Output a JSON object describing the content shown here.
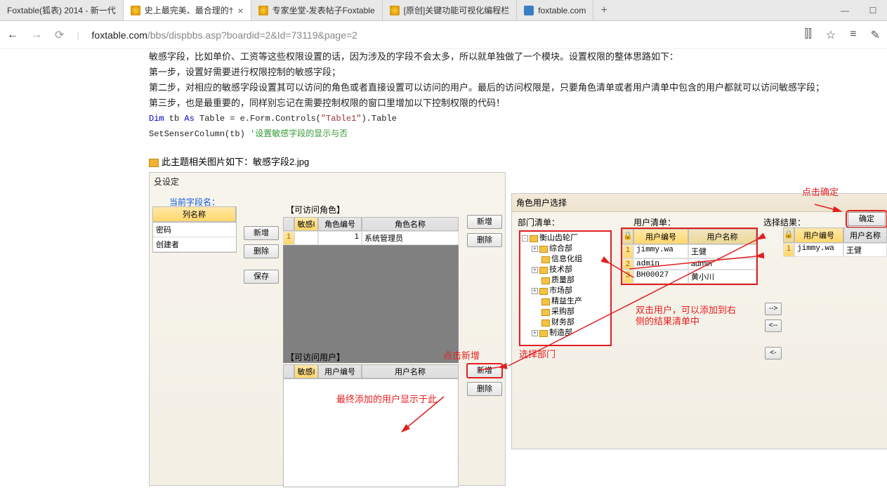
{
  "tabs": [
    {
      "title": "Foxtable(狐表) 2014 - 新一代"
    },
    {
      "title": "史上最完美、最合理的†"
    },
    {
      "title": "专家坐堂-发表帖子Foxtable"
    },
    {
      "title": "[原创]关键功能可视化编程栏"
    },
    {
      "title": "foxtable.com"
    }
  ],
  "url_prefix": "foxtable.com",
  "url_path": "/bbs/dispbbs.asp?boardid=2&Id=73119&page=2",
  "text": {
    "l1": "敏感字段，比如单价、工资等这些权限设置的话，因为涉及的字段不会太多，所以就单独做了一个模块。设置权限的整体思路如下：",
    "l2": "第一步，设置好需要进行权限控制的敏感字段；",
    "l3": "第二步，对相应的敏感字段设置其可以访问的角色或者直接设置可以访问的用户。最后的访问权限是，只要角色清单或者用户清单中包含的用户都就可以访问敏感字段；",
    "l4": "第三步，也是最重要的，同样别忘记在需要控制权限的窗口里增加以下控制权限的代码！",
    "code1a": "Dim",
    "code1b": " tb ",
    "code1c": "As",
    "code1d": " Table = e.Form.Controls(",
    "code1e": "\"Table1\"",
    "code1f": ").Table",
    "code2a": "SetSenserColumn(tb)   ",
    "code2b": "'设置敏感字段的显示与否"
  },
  "caption": "此主题相关图片如下：敏感字段2.jpg",
  "panel1": {
    "tabset": "殳设定",
    "field_label": "当前字段名：",
    "col_header": "列名称",
    "rows": [
      "密码",
      "创建者"
    ],
    "btn_new": "新增",
    "btn_del": "删除",
    "btn_save": "保存",
    "roles_label": "【可访问角色】",
    "roles_head": [
      "敏感I",
      "角色编号",
      "角色名称"
    ],
    "roles_row": [
      "1",
      "",
      "1",
      "系统管理员"
    ],
    "users_label": "【可访问用户】",
    "users_head": [
      "敏感I",
      "用户编号",
      "用户名称"
    ]
  },
  "annos": {
    "a1": "点击新增",
    "a2": "最终添加的用户显示于此",
    "a3": "选择部门",
    "a4": "双击用户，可以添加到右侧的结果清单中",
    "a5": "点击确定"
  },
  "panel2": {
    "title": "角色用户选择",
    "lbl_dept": "部门清单：",
    "lbl_users": "用户清单：",
    "lbl_result": "选择结果：",
    "ok": "确定",
    "tree": [
      "衡山齿轮厂",
      "综合部",
      "信息化组",
      "技术部",
      "质量部",
      "市场部",
      "精益生产",
      "采购部",
      "财务部",
      "制造部"
    ],
    "user_head": [
      "用户编号",
      "用户名称"
    ],
    "users": [
      {
        "n": "1",
        "id": "jimmy.wa",
        "name": "王健"
      },
      {
        "n": "2",
        "id": "admin",
        "name": "admin"
      },
      {
        "n": "3",
        "id": "BH00027",
        "name": "黄小川"
      }
    ],
    "res_head": [
      "用户编号",
      "用户名称"
    ],
    "result": [
      {
        "n": "1",
        "id": "jimmy.wa",
        "name": "王健"
      }
    ],
    "move": [
      "-->",
      "<--",
      "<-"
    ]
  },
  "chart_data": null
}
